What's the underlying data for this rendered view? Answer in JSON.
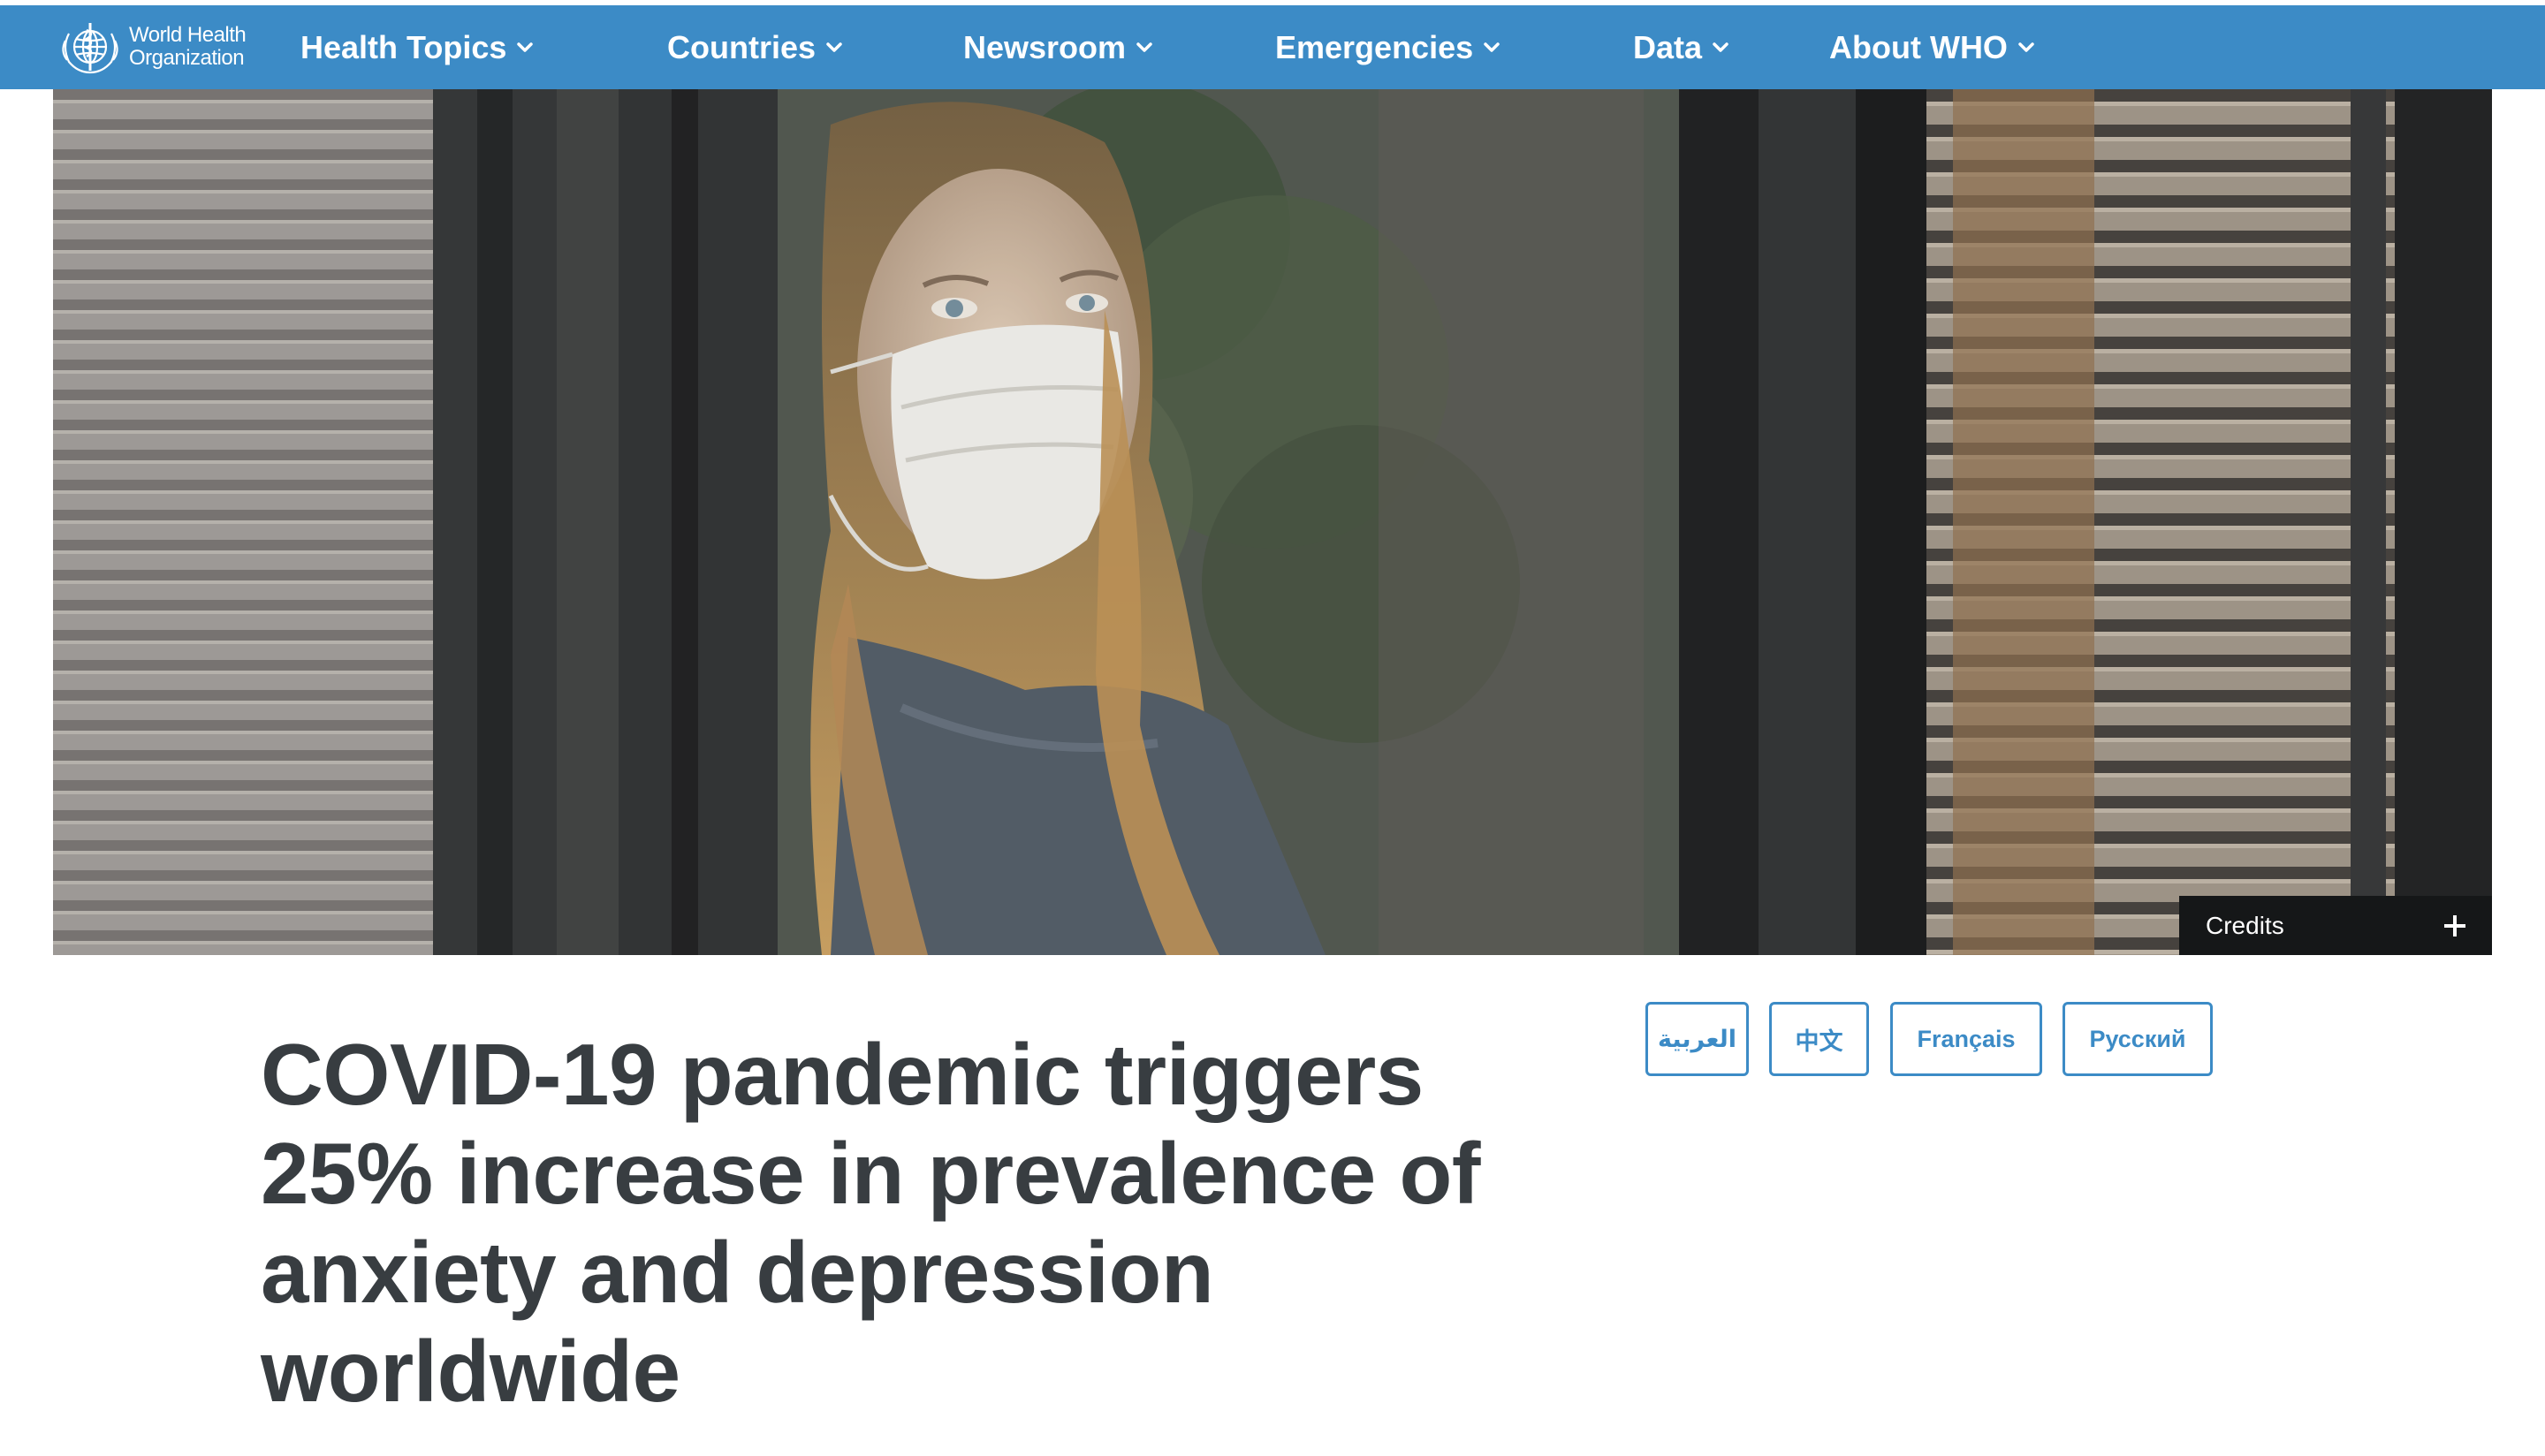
{
  "header": {
    "logo_line1": "World Health",
    "logo_line2": "Organization",
    "nav": [
      {
        "label": "Health Topics"
      },
      {
        "label": "Countries"
      },
      {
        "label": "Newsroom"
      },
      {
        "label": "Emergencies"
      },
      {
        "label": "Data"
      },
      {
        "label": "About WHO"
      }
    ]
  },
  "hero": {
    "credits_label": "Credits"
  },
  "languages": [
    {
      "label": "العربية"
    },
    {
      "label": "中文"
    },
    {
      "label": "Français"
    },
    {
      "label": "Русский"
    }
  ],
  "article": {
    "title": "COVID-19 pandemic triggers 25% increase in prevalence of anxiety and depression worldwide"
  },
  "colors": {
    "nav_bg": "#3c8bc6",
    "headline_text": "#383d41",
    "credits_bg": "#151718",
    "lang_border": "#3c8bc6"
  },
  "icons": [
    "who-emblem-icon",
    "chevron-down-icon",
    "plus-icon"
  ]
}
